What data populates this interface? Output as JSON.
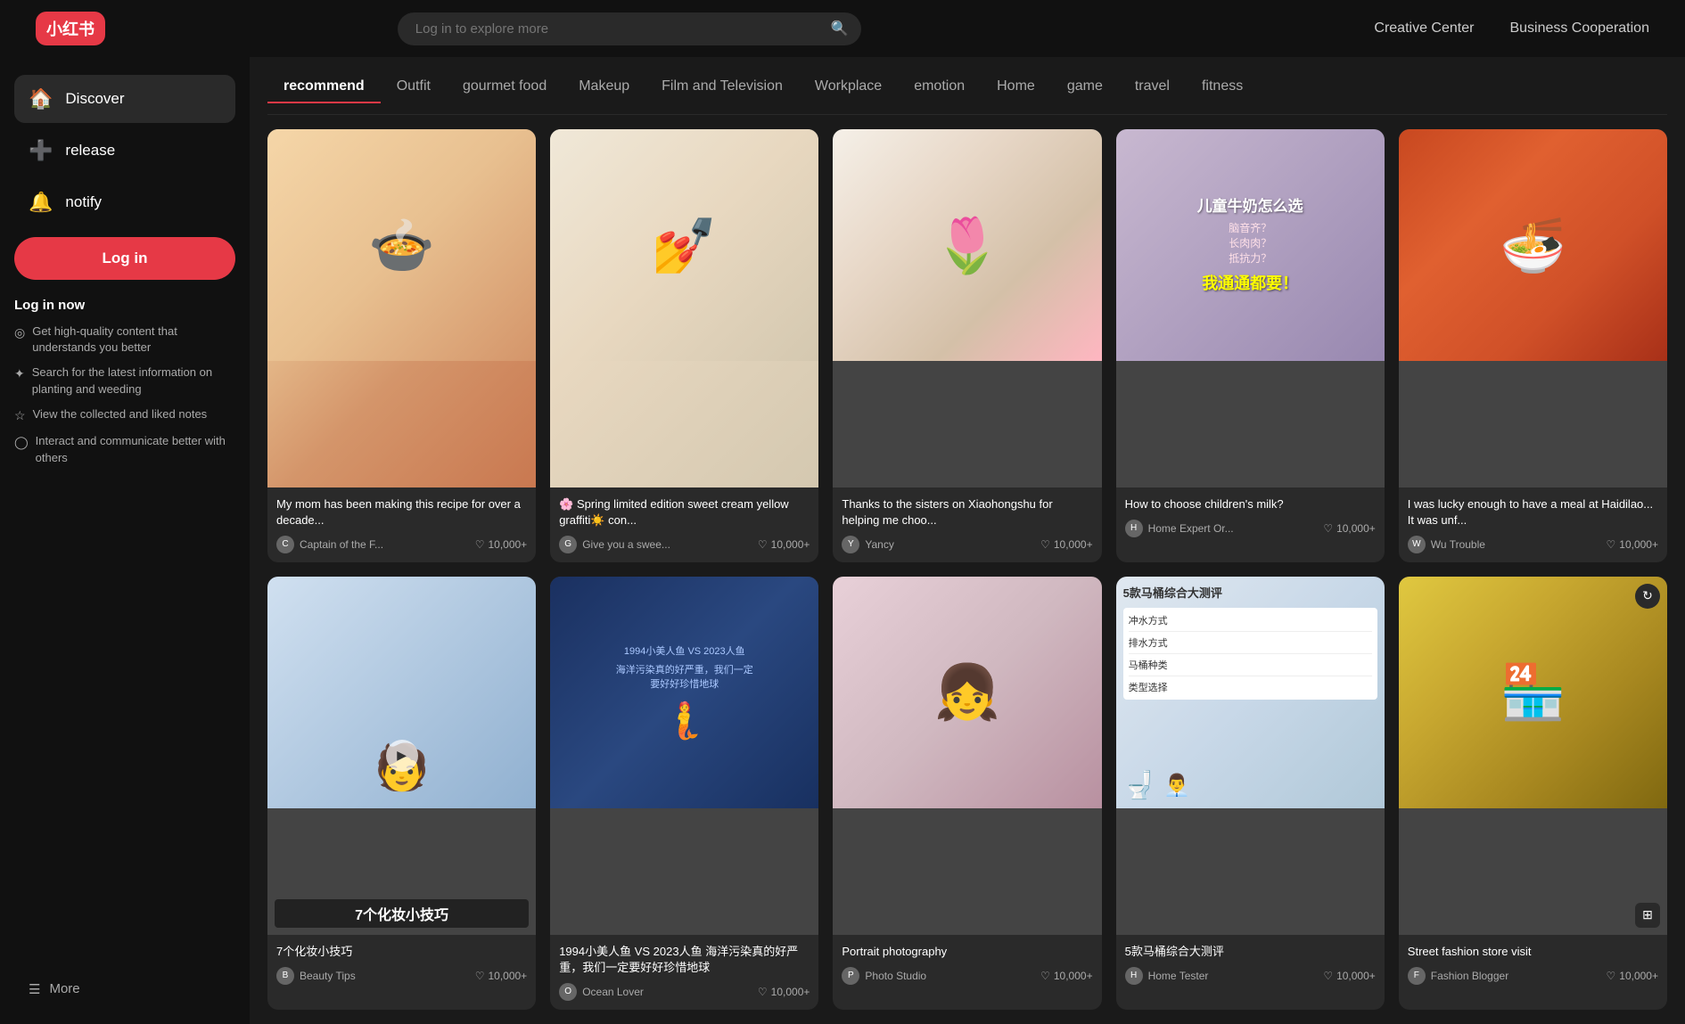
{
  "header": {
    "logo": "小红书",
    "search_placeholder": "Log in to explore more",
    "creative_center": "Creative Center",
    "business_cooperation": "Business Cooperation"
  },
  "sidebar": {
    "items": [
      {
        "id": "discover",
        "label": "Discover",
        "icon": "🏠"
      },
      {
        "id": "release",
        "label": "release",
        "icon": "➕"
      },
      {
        "id": "notify",
        "label": "notify",
        "icon": "🔔"
      }
    ],
    "login_button": "Log in",
    "login_now_title": "Log in now",
    "benefits": [
      "Get high-quality content that understands you better",
      "Search for the latest information on planting and weeding",
      "View the collected and liked notes",
      "Interact and communicate better with others"
    ],
    "benefit_icons": [
      "◎",
      "✦",
      "☆",
      "◯"
    ],
    "more_label": "More"
  },
  "nav_tabs": [
    {
      "id": "recommend",
      "label": "recommend",
      "active": true
    },
    {
      "id": "outfit",
      "label": "Outfit"
    },
    {
      "id": "gourmet",
      "label": "gourmet food"
    },
    {
      "id": "makeup",
      "label": "Makeup"
    },
    {
      "id": "film",
      "label": "Film and Television"
    },
    {
      "id": "workplace",
      "label": "Workplace"
    },
    {
      "id": "emotion",
      "label": "emotion"
    },
    {
      "id": "home",
      "label": "Home"
    },
    {
      "id": "game",
      "label": "game"
    },
    {
      "id": "travel",
      "label": "travel"
    },
    {
      "id": "fitness",
      "label": "fitness"
    }
  ],
  "cards": [
    {
      "id": "card1",
      "title": "My mom has been making this recipe for over a decade...",
      "author": "Captain of the F...",
      "likes": "10,000+",
      "img_type": "food1",
      "has_video": false,
      "overlay": null
    },
    {
      "id": "card2",
      "title": "🌸 Spring limited edition sweet cream yellow graffiti☀️ con...",
      "author": "Give you a swee...",
      "likes": "10,000+",
      "img_type": "nail",
      "has_video": false,
      "overlay": null
    },
    {
      "id": "card3",
      "title": "Thanks to the sisters on Xiaohongshu for helping me choo...",
      "author": "Yancy",
      "likes": "10,000+",
      "img_type": "flower",
      "has_video": false,
      "overlay": null
    },
    {
      "id": "card4",
      "title": "How to choose children's milk?",
      "author": "Home Expert Or...",
      "likes": "10,000+",
      "img_type": "child",
      "has_video": false,
      "overlay": {
        "lines": [
          "儿童牛奶怎么选",
          "脑音齐？",
          "长肉肉？",
          "抵抗力？",
          "我通通都要！"
        ]
      }
    },
    {
      "id": "card5",
      "title": "I was lucky enough to have a meal at Haidilao... It was unf...",
      "author": "Wu Trouble",
      "likes": "10,000+",
      "img_type": "hotpot",
      "has_video": false,
      "overlay": null
    },
    {
      "id": "card6",
      "title": "7个化妆小技巧",
      "author": "Beauty Tips",
      "likes": "10,000+",
      "img_type": "guy",
      "has_video": true,
      "overlay": {
        "lines": [
          "7个化妆小技巧"
        ]
      }
    },
    {
      "id": "card7",
      "title": "1994小美人鱼 VS 2023人鱼 海洋污染真的好严重，我们一定要好好珍惜地球",
      "author": "Ocean Lover",
      "likes": "10,000+",
      "img_type": "mermaid",
      "has_video": false,
      "overlay": null
    },
    {
      "id": "card8",
      "title": "Portrait photography",
      "author": "Photo Studio",
      "likes": "10,000+",
      "img_type": "girl",
      "has_video": false,
      "overlay": null
    },
    {
      "id": "card9",
      "title": "5款马桶综合大测评",
      "author": "Home Tester",
      "likes": "10,000+",
      "img_type": "toilet",
      "has_video": false,
      "overlay": {
        "lines": [
          "5款马桶综合大测评",
          "冲水方式",
          "排水方式",
          "马桶种类",
          "类型选择"
        ]
      }
    },
    {
      "id": "card10",
      "title": "Street fashion store visit",
      "author": "Fashion Blogger",
      "likes": "10,000+",
      "img_type": "shop",
      "has_video": false,
      "overlay": null
    }
  ]
}
